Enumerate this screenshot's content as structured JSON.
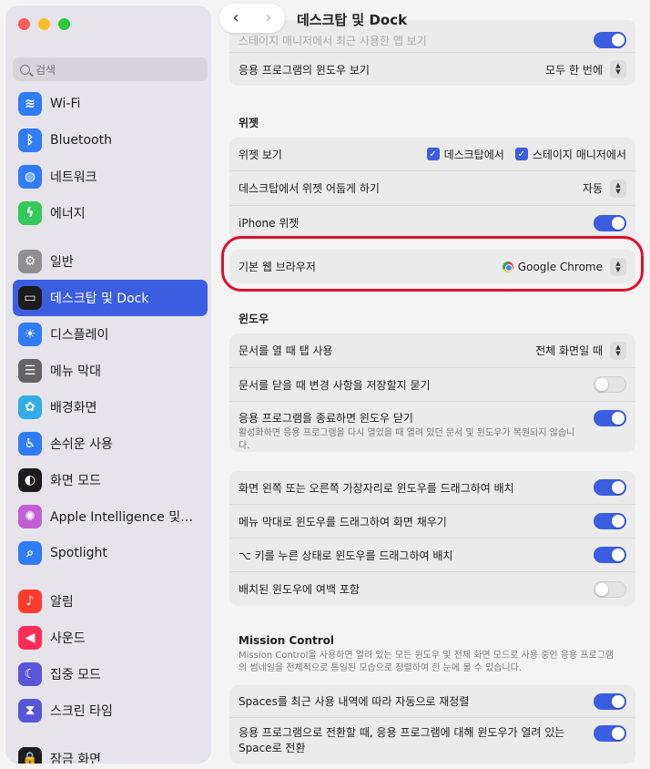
{
  "window": {
    "title": "데스크탑 및 Dock"
  },
  "sidebar": {
    "search_placeholder": "검색",
    "groups": [
      [
        {
          "label": "Wi-Fi",
          "icon": "wifi-icon",
          "color": "#2f7cf6",
          "glyph": "≋"
        },
        {
          "label": "Bluetooth",
          "icon": "bluetooth-icon",
          "color": "#2f7cf6",
          "glyph": "ᛒ"
        },
        {
          "label": "네트워크",
          "icon": "globe-icon",
          "color": "#2f7cf6",
          "glyph": "◍"
        },
        {
          "label": "에너지",
          "icon": "battery-icon",
          "color": "#34c759",
          "glyph": "ϟ"
        }
      ],
      [
        {
          "label": "일반",
          "icon": "gear-icon",
          "color": "#8e8e93",
          "glyph": "⚙"
        },
        {
          "label": "데스크탑 및 Dock",
          "icon": "dock-icon",
          "color": "#1c1c1e",
          "glyph": "▭",
          "selected": true
        },
        {
          "label": "디스플레이",
          "icon": "display-icon",
          "color": "#2f7cf6",
          "glyph": "☀"
        },
        {
          "label": "메뉴 막대",
          "icon": "menubar-icon",
          "color": "#636366",
          "glyph": "☰"
        },
        {
          "label": "배경화면",
          "icon": "wallpaper-icon",
          "color": "#32ade6",
          "glyph": "✿"
        },
        {
          "label": "손쉬운 사용",
          "icon": "accessibility-icon",
          "color": "#2f7cf6",
          "glyph": "♿"
        },
        {
          "label": "화면 모드",
          "icon": "appearance-icon",
          "color": "#1c1c1e",
          "glyph": "◐"
        },
        {
          "label": "Apple Intelligence 및…",
          "icon": "apple-intelligence-icon",
          "color": "#c35fd6",
          "glyph": "✺"
        },
        {
          "label": "Spotlight",
          "icon": "spotlight-icon",
          "color": "#2f7cf6",
          "glyph": "⌕"
        }
      ],
      [
        {
          "label": "알림",
          "icon": "bell-icon",
          "color": "#ff3b30",
          "glyph": "♪"
        },
        {
          "label": "사운드",
          "icon": "speaker-icon",
          "color": "#ff2d55",
          "glyph": "◀"
        },
        {
          "label": "집중 모드",
          "icon": "moon-icon",
          "color": "#5856d6",
          "glyph": "☾"
        },
        {
          "label": "스크린 타임",
          "icon": "hourglass-icon",
          "color": "#5856d6",
          "glyph": "⧗"
        }
      ],
      [
        {
          "label": "잠금 화면",
          "icon": "lock-icon",
          "color": "#1c1c1e",
          "glyph": "🔒"
        }
      ]
    ]
  },
  "main": {
    "top_card": {
      "partial_label": "스테이지 매니저에서 최근 사용한 앱 보기",
      "row_label": "응용 프로그램의 윈도우 보기",
      "row_value": "모두 한 번에"
    },
    "widgets": {
      "title": "위젯",
      "show_label": "위젯 보기",
      "cb_desktop": "데스크탑에서",
      "cb_stage": "스테이지 매니저에서",
      "dim_label": "데스크탑에서 위젯 어둡게 하기",
      "dim_value": "자동",
      "iphone_label": "iPhone 위젯"
    },
    "browser": {
      "label": "기본 웹 브라우저",
      "value": "Google Chrome"
    },
    "windows": {
      "title": "윈도우",
      "tabs_label": "문서를 열 때 탭 사용",
      "tabs_value": "전체 화면일 때",
      "ask_label": "문서를 닫을 때 변경 사항을 저장할지 묻기",
      "close_label": "응용 프로그램을 종료하면 윈도우 닫기",
      "close_sub": "활성화하면 응용 프로그램을 다시 열었을 때 열려 있던 문서 및 윈도우가 복원되지 않습니다."
    },
    "tiling": {
      "edge_label": "화면 왼쪽 또는 오른쪽 가장자리로 윈도우를 드래그하여 배치",
      "menubar_label": "메뉴 막대로 윈도우를 드래그하여 화면 채우기",
      "option_label": "⌥ 키를 누른 상태로 윈도우를 드래그하여 배치",
      "margin_label": "배치된 윈도우에 여백 포함"
    },
    "mission": {
      "title": "Mission Control",
      "desc": "Mission Control을 사용하면 열려 있는 모든 윈도우 및 전체 화면 모드로 사용 중인 응용 프로그램의 썸네일을 전체적으로 통일된 모습으로 정렬하여 한 눈에 볼 수 있습니다.",
      "spaces_label": "Spaces를 최근 사용 내역에 따라 자동으로 재정렬",
      "switch_label": "응용 프로그램으로 전환할 때, 응용 프로그램에 대해 윈도우가 열려 있는 Space로 전환"
    }
  }
}
